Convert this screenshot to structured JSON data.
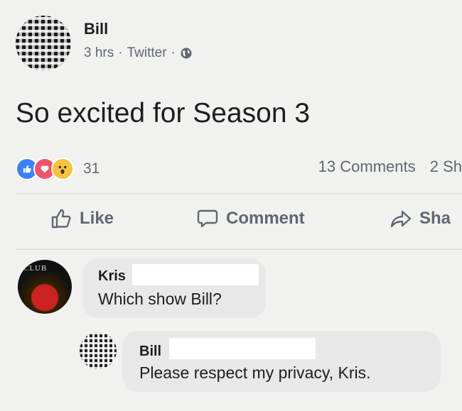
{
  "post": {
    "author": "Bill",
    "time": "3 hrs",
    "source": "Twitter",
    "separator": "·",
    "privacy_icon": "globe-icon",
    "text": "So excited for Season 3"
  },
  "stats": {
    "reactions": [
      "like",
      "love",
      "wow"
    ],
    "reaction_count": "31",
    "comments": "13 Comments",
    "shares": "2 Sh"
  },
  "actions": {
    "like": "Like",
    "comment": "Comment",
    "share": "Sha"
  },
  "comments": [
    {
      "name": "Kris",
      "text": "Which show Bill?",
      "avatar_text": "CLUB"
    },
    {
      "name": "Bill",
      "text": "Please respect my privacy, Kris."
    }
  ],
  "colors": {
    "like_blue": "#3b82f6",
    "love_red": "#f0546b",
    "wow_yellow": "#f7c23b",
    "muted_text": "#606770",
    "bubble_bg": "#e8e8e8"
  }
}
